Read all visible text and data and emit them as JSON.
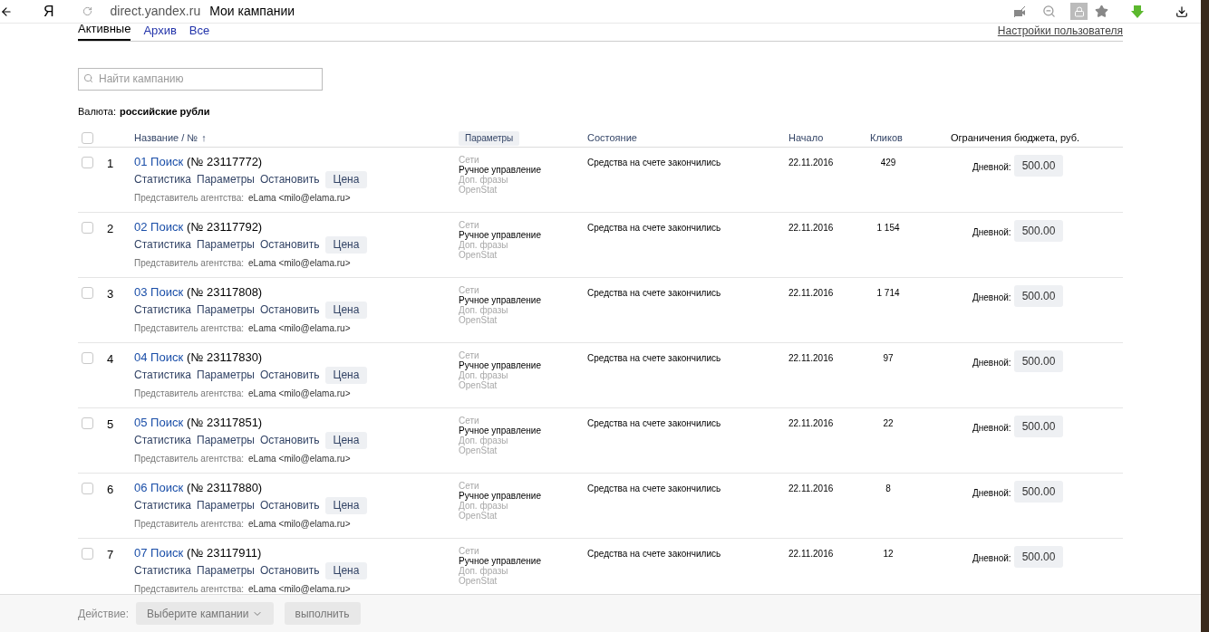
{
  "browser": {
    "logo": "Я",
    "url": "direct.yandex.ru",
    "title": "Мои кампании"
  },
  "tabs": [
    {
      "label": "Активные",
      "selected": true
    },
    {
      "label": "Архив",
      "selected": false
    },
    {
      "label": "Все",
      "selected": false
    }
  ],
  "user_settings_link": "Настройки пользователя",
  "search": {
    "placeholder": "Найти кампанию"
  },
  "currency": {
    "label": "Валюта:",
    "value": "российские рубли"
  },
  "table": {
    "header_checkbox": {
      "checked": false
    },
    "columns": {
      "name": "Название / №",
      "sort_mark": "↑",
      "params_button": "Параметры",
      "state": "Состояние",
      "start": "Начало",
      "clicks": "Кликов",
      "budget": "Ограничения бюджета, руб."
    },
    "rows": [
      {
        "checked": false,
        "number": "1",
        "name": "01 Поиск",
        "id": "(№ 23117772)",
        "actions": [
          "Статистика",
          "Параметры",
          "Остановить"
        ],
        "price_button": "Цена",
        "agent_label": "Представитель агентства:",
        "agent": "eLama <milo@elama.ru>",
        "params": [
          {
            "text": "Сети",
            "active": false
          },
          {
            "text": "Ручное управление",
            "active": true
          },
          {
            "text": "Доп. фразы",
            "active": false
          },
          {
            "text": "OpenStat",
            "active": false
          }
        ],
        "state": "Средства на счете закончились",
        "start": "22.11.2016",
        "clicks": "429",
        "budget_label": "Дневной:",
        "budget": "500.00"
      },
      {
        "checked": false,
        "number": "2",
        "name": "02 Поиск",
        "id": "(№ 23117792)",
        "actions": [
          "Статистика",
          "Параметры",
          "Остановить"
        ],
        "price_button": "Цена",
        "agent_label": "Представитель агентства:",
        "agent": "eLama <milo@elama.ru>",
        "params": [
          {
            "text": "Сети",
            "active": false
          },
          {
            "text": "Ручное управление",
            "active": true
          },
          {
            "text": "Доп. фразы",
            "active": false
          },
          {
            "text": "OpenStat",
            "active": false
          }
        ],
        "state": "Средства на счете закончились",
        "start": "22.11.2016",
        "clicks": "1 154",
        "budget_label": "Дневной:",
        "budget": "500.00"
      },
      {
        "checked": false,
        "number": "3",
        "name": "03 Поиск",
        "id": "(№ 23117808)",
        "actions": [
          "Статистика",
          "Параметры",
          "Остановить"
        ],
        "price_button": "Цена",
        "agent_label": "Представитель агентства:",
        "agent": "eLama <milo@elama.ru>",
        "params": [
          {
            "text": "Сети",
            "active": false
          },
          {
            "text": "Ручное управление",
            "active": true
          },
          {
            "text": "Доп. фразы",
            "active": false
          },
          {
            "text": "OpenStat",
            "active": false
          }
        ],
        "state": "Средства на счете закончились",
        "start": "22.11.2016",
        "clicks": "1 714",
        "budget_label": "Дневной:",
        "budget": "500.00"
      },
      {
        "checked": false,
        "number": "4",
        "name": "04 Поиск",
        "id": "(№ 23117830)",
        "actions": [
          "Статистика",
          "Параметры",
          "Остановить"
        ],
        "price_button": "Цена",
        "agent_label": "Представитель агентства:",
        "agent": "eLama <milo@elama.ru>",
        "params": [
          {
            "text": "Сети",
            "active": false
          },
          {
            "text": "Ручное управление",
            "active": true
          },
          {
            "text": "Доп. фразы",
            "active": false
          },
          {
            "text": "OpenStat",
            "active": false
          }
        ],
        "state": "Средства на счете закончились",
        "start": "22.11.2016",
        "clicks": "97",
        "budget_label": "Дневной:",
        "budget": "500.00"
      },
      {
        "checked": false,
        "number": "5",
        "name": "05 Поиск",
        "id": "(№ 23117851)",
        "actions": [
          "Статистика",
          "Параметры",
          "Остановить"
        ],
        "price_button": "Цена",
        "agent_label": "Представитель агентства:",
        "agent": "eLama <milo@elama.ru>",
        "params": [
          {
            "text": "Сети",
            "active": false
          },
          {
            "text": "Ручное управление",
            "active": true
          },
          {
            "text": "Доп. фразы",
            "active": false
          },
          {
            "text": "OpenStat",
            "active": false
          }
        ],
        "state": "Средства на счете закончились",
        "start": "22.11.2016",
        "clicks": "22",
        "budget_label": "Дневной:",
        "budget": "500.00"
      },
      {
        "checked": false,
        "number": "6",
        "name": "06 Поиск",
        "id": "(№ 23117880)",
        "actions": [
          "Статистика",
          "Параметры",
          "Остановить"
        ],
        "price_button": "Цена",
        "agent_label": "Представитель агентства:",
        "agent": "eLama <milo@elama.ru>",
        "params": [
          {
            "text": "Сети",
            "active": false
          },
          {
            "text": "Ручное управление",
            "active": true
          },
          {
            "text": "Доп. фразы",
            "active": false
          },
          {
            "text": "OpenStat",
            "active": false
          }
        ],
        "state": "Средства на счете закончились",
        "start": "22.11.2016",
        "clicks": "8",
        "budget_label": "Дневной:",
        "budget": "500.00"
      },
      {
        "checked": false,
        "number": "7",
        "name": "07 Поиск",
        "id": "(№ 23117911)",
        "actions": [
          "Статистика",
          "Параметры",
          "Остановить"
        ],
        "price_button": "Цена",
        "agent_label": "Представитель агентства:",
        "agent": "eLama <milo@elama.ru>",
        "params": [
          {
            "text": "Сети",
            "active": false
          },
          {
            "text": "Ручное управление",
            "active": true
          },
          {
            "text": "Доп. фразы",
            "active": false
          },
          {
            "text": "OpenStat",
            "active": false
          }
        ],
        "state": "Средства на счете закончились",
        "start": "22.11.2016",
        "clicks": "12",
        "budget_label": "Дневной:",
        "budget": "500.00"
      }
    ]
  },
  "action_bar": {
    "label": "Действие:",
    "select": "Выберите кампании",
    "submit": "выполнить"
  }
}
